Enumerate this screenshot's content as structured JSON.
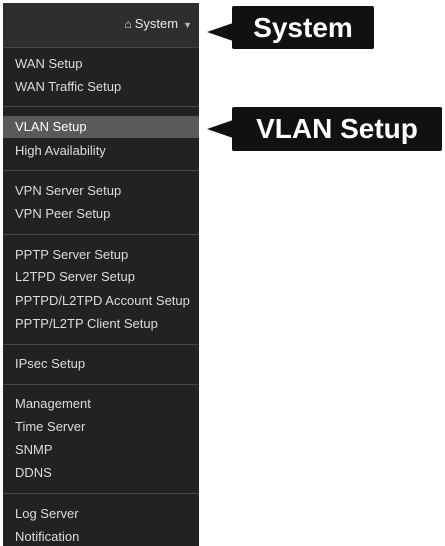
{
  "header": {
    "home_icon": "home-icon",
    "system_label": "System",
    "caret_icon": "caret-down-icon"
  },
  "menu": {
    "items": [
      {
        "label": "WAN Setup"
      },
      {
        "label": "WAN Traffic Setup"
      },
      {
        "label": "VLAN Setup",
        "active": true
      },
      {
        "label": "High Availability"
      },
      {
        "label": "VPN Server Setup"
      },
      {
        "label": "VPN Peer Setup"
      },
      {
        "label": "PPTP Server Setup"
      },
      {
        "label": "L2TPD Server Setup"
      },
      {
        "label": "PPTPD/L2TPD Account Setup"
      },
      {
        "label": "PPTP/L2TP Client Setup"
      },
      {
        "label": "IPsec Setup"
      },
      {
        "label": "Management"
      },
      {
        "label": "Time Server"
      },
      {
        "label": "SNMP"
      },
      {
        "label": "DDNS"
      },
      {
        "label": "Log Server"
      },
      {
        "label": "Notification"
      }
    ]
  },
  "callouts": {
    "system": "System",
    "vlan": "VLAN Setup"
  },
  "colors": {
    "menu_bg": "#222222",
    "active_bg": "#5a5a5a",
    "callout_bg": "#111111"
  }
}
